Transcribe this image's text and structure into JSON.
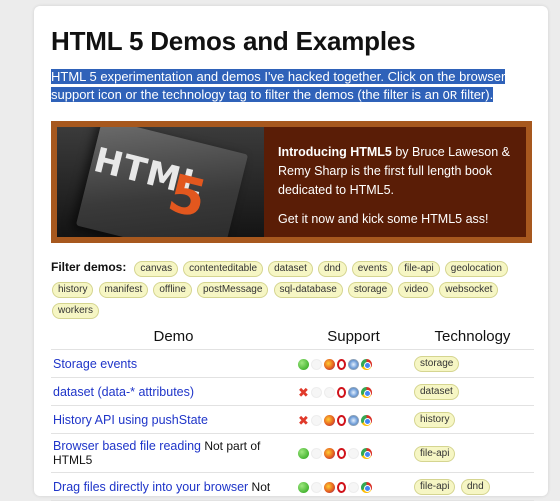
{
  "page": {
    "title": "HTML 5 Demos and Examples",
    "intro_text": "HTML 5 experimentation and demos I've hacked together. Click on the browser support icon or the technology tag to filter the demos (the filter is an ",
    "intro_or": "OR",
    "intro_end": " filter)."
  },
  "promo": {
    "book_word": "HTML",
    "book_number": "5",
    "title_bold": "Introducing HTML5",
    "line1_rest": " by Bruce Laweson & Remy Sharp is the first full length book dedicated to HTML5.",
    "line2": "Get it now and kick some HTML5 ass!"
  },
  "filter": {
    "label": "Filter demos:",
    "tags": [
      "canvas",
      "contenteditable",
      "dataset",
      "dnd",
      "events",
      "file-api",
      "geolocation",
      "history",
      "manifest",
      "offline",
      "postMessage",
      "sql-database",
      "storage",
      "video",
      "websocket",
      "workers"
    ]
  },
  "table": {
    "headers": [
      "Demo",
      "Support",
      "Technology"
    ],
    "rows": [
      {
        "name": "Storage events",
        "note": "",
        "support": [
          "yes",
          "faded",
          "ff",
          "op",
          "sf",
          "ch"
        ],
        "tags": [
          "storage"
        ]
      },
      {
        "name": "dataset (data-* attributes)",
        "note": "",
        "support": [
          "no",
          "faded",
          "faded",
          "op",
          "sf",
          "ch"
        ],
        "tags": [
          "dataset"
        ]
      },
      {
        "name": "History API using pushState",
        "note": "",
        "support": [
          "no",
          "faded",
          "ff",
          "op",
          "sf",
          "ch"
        ],
        "tags": [
          "history"
        ]
      },
      {
        "name": "Browser based file reading",
        "note": " Not part of HTML5",
        "support": [
          "yes",
          "faded",
          "ff",
          "op",
          "faded",
          "ch"
        ],
        "tags": [
          "file-api"
        ]
      },
      {
        "name": "Drag files directly into your browser",
        "note": " Not",
        "support": [
          "yes",
          "faded",
          "ff",
          "op",
          "faded",
          "ch"
        ],
        "tags": [
          "file-api",
          "dnd"
        ]
      }
    ]
  },
  "colors": {
    "highlight": "#2f62b9",
    "promo_border": "#a7581e",
    "promo_bg": "#5a1d06",
    "link": "#1f35c9",
    "tag_bg": "#f6f6c4"
  }
}
